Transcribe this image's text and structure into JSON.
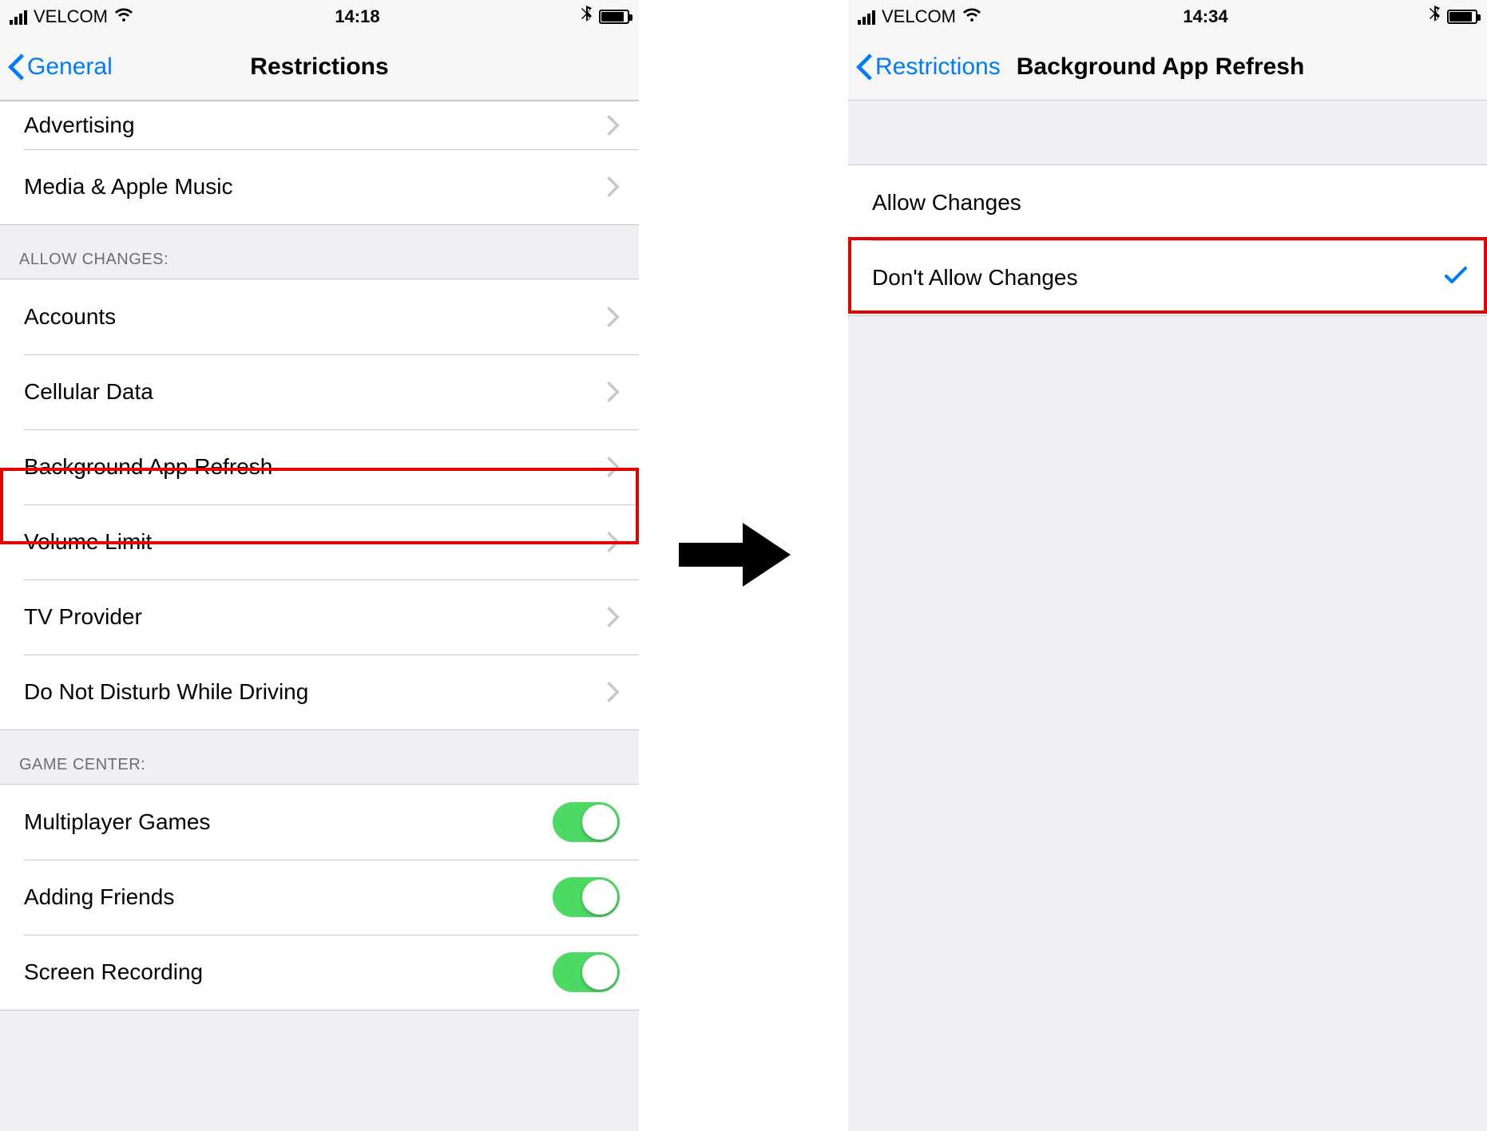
{
  "carrier": "VELCOM",
  "left": {
    "time": "14:18",
    "nav_back": "General",
    "nav_title": "Restrictions",
    "top_rows": [
      "Advertising",
      "Media & Apple Music"
    ],
    "section_allow_header": "ALLOW CHANGES:",
    "allow_rows": [
      "Accounts",
      "Cellular Data",
      "Background App Refresh",
      "Volume Limit",
      "TV Provider",
      "Do Not Disturb While Driving"
    ],
    "game_center_header": "GAME CENTER:",
    "game_center_rows": [
      "Multiplayer Games",
      "Adding Friends",
      "Screen Recording"
    ]
  },
  "right": {
    "time": "14:34",
    "nav_back": "Restrictions",
    "nav_title": "Background App Refresh",
    "options": [
      "Allow Changes",
      "Don't Allow Changes"
    ],
    "selected_index": 1
  },
  "colors": {
    "ios_blue": "#007aff",
    "ios_green": "#4cd964",
    "highlight_red": "#e70000"
  }
}
